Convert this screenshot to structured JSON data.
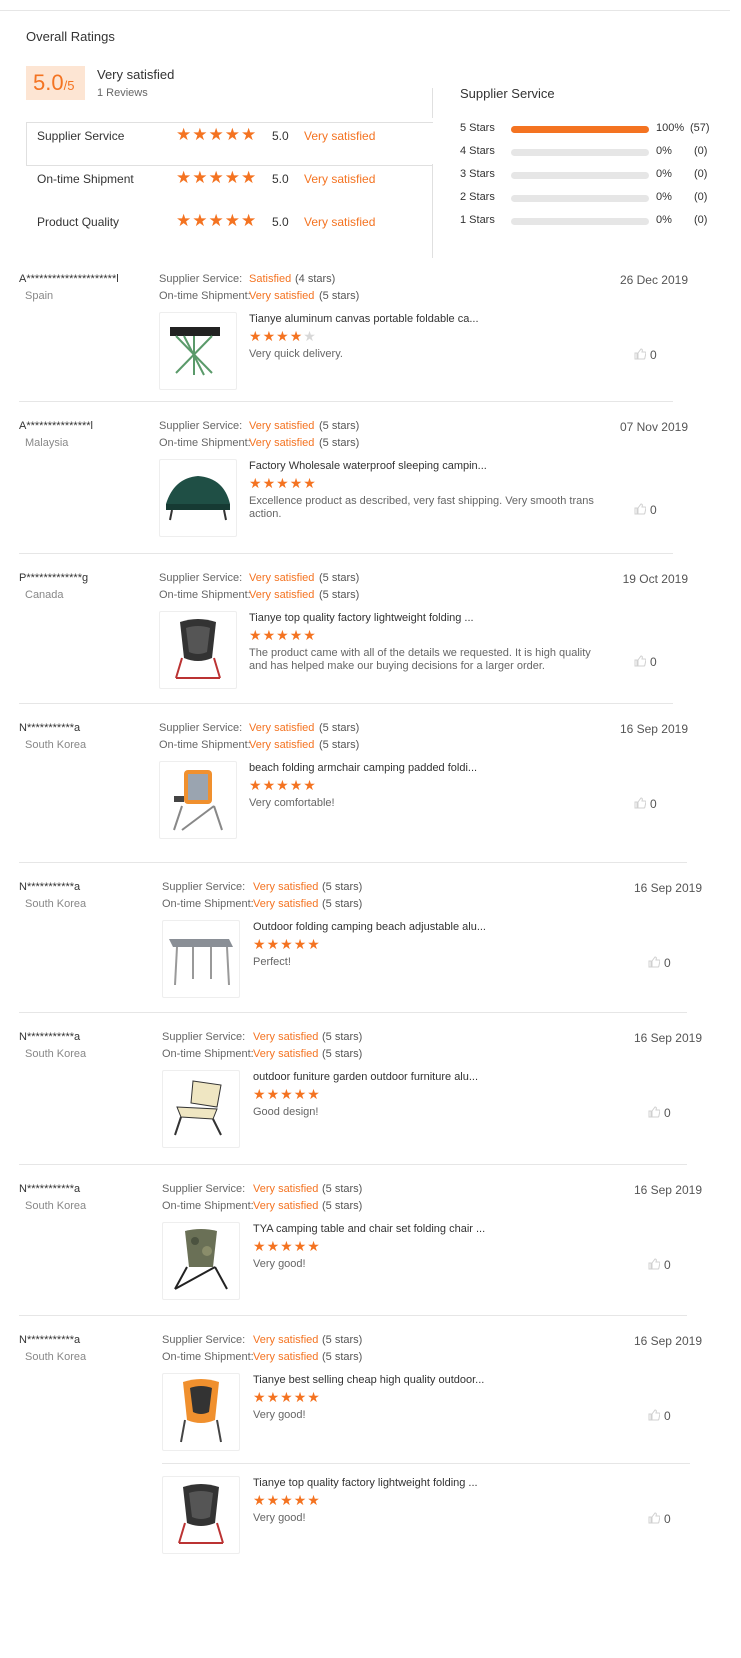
{
  "overall": {
    "title": "Overall Ratings",
    "score": "5.0",
    "score_suffix": "/5",
    "label": "Very satisfied",
    "reviews": "1 Reviews",
    "categories": [
      {
        "name": "Supplier Service",
        "score": "5.0",
        "rating_word": "Very satisfied",
        "stars": 5
      },
      {
        "name": "On-time Shipment",
        "score": "5.0",
        "rating_word": "Very satisfied",
        "stars": 5
      },
      {
        "name": "Product Quality",
        "score": "5.0",
        "rating_word": "Very satisfied",
        "stars": 5
      }
    ]
  },
  "supplier_breakdown": {
    "title": "Supplier Service",
    "rows": [
      {
        "label": "5 Stars",
        "pct": "100%",
        "count": "(57)",
        "fraction": 1.0
      },
      {
        "label": "4 Stars",
        "pct": "0%",
        "count": "(0)",
        "fraction": 0
      },
      {
        "label": "3 Stars",
        "pct": "0%",
        "count": "(0)",
        "fraction": 0
      },
      {
        "label": "2 Stars",
        "pct": "0%",
        "count": "(0)",
        "fraction": 0
      },
      {
        "label": "1 Stars",
        "pct": "0%",
        "count": "(0)",
        "fraction": 0
      }
    ]
  },
  "labels": {
    "supplier_service": "Supplier Service:",
    "ontime_shipment": "On-time Shipment:"
  },
  "reviews": [
    {
      "name": "A*********************l",
      "country": "Spain",
      "supplier_value": "Satisfied",
      "supplier_stars": "(4 stars)",
      "shipment_value": "Very satisfied",
      "shipment_stars": "(5 stars)",
      "date": "26 Dec 2019",
      "products": [
        {
          "title": "Tianye aluminum canvas portable foldable ca...",
          "rating": 4,
          "text": "Very quick delivery.",
          "likes": "0",
          "image": "folding-table-icon"
        }
      ]
    },
    {
      "name": "A***************l",
      "country": "Malaysia",
      "supplier_value": "Very satisfied",
      "supplier_stars": "(5 stars)",
      "shipment_value": "Very satisfied",
      "shipment_stars": "(5 stars)",
      "date": "07 Nov 2019",
      "products": [
        {
          "title": "Factory Wholesale waterproof sleeping campin...",
          "rating": 5,
          "text": "Excellence product as described, very fast shipping. Very smooth trans action.",
          "likes": "0",
          "image": "tent-cot-icon"
        }
      ]
    },
    {
      "name": "P*************g",
      "country": "Canada",
      "supplier_value": "Very satisfied",
      "supplier_stars": "(5 stars)",
      "shipment_value": "Very satisfied",
      "shipment_stars": "(5 stars)",
      "date": "19 Oct 2019",
      "products": [
        {
          "title": "Tianye top quality factory lightweight folding ...",
          "rating": 5,
          "text": "The product came with all of the details we requested.  It is high quality and has helped make our buying decisions for a larger order.",
          "likes": "0",
          "image": "camping-chair-icon"
        }
      ]
    },
    {
      "name": "N***********a",
      "country": "South Korea",
      "supplier_value": "Very satisfied",
      "supplier_stars": "(5 stars)",
      "shipment_value": "Very satisfied",
      "shipment_stars": "(5 stars)",
      "date": "16 Sep 2019",
      "products": [
        {
          "title": "beach folding armchair camping padded foldi...",
          "rating": 5,
          "text": "Very comfortable!",
          "likes": "0",
          "image": "armchair-icon"
        }
      ]
    },
    {
      "name": "N***********a",
      "country": "South Korea",
      "supplier_value": "Very satisfied",
      "supplier_stars": "(5 stars)",
      "shipment_value": "Very satisfied",
      "shipment_stars": "(5 stars)",
      "date": "16 Sep 2019",
      "products": [
        {
          "title": "Outdoor folding camping beach adjustable alu...",
          "rating": 5,
          "text": "Perfect!",
          "likes": "0",
          "image": "alu-table-icon"
        }
      ]
    },
    {
      "name": "N***********a",
      "country": "South Korea",
      "supplier_value": "Very satisfied",
      "supplier_stars": "(5 stars)",
      "shipment_value": "Very satisfied",
      "shipment_stars": "(5 stars)",
      "date": "16 Sep 2019",
      "products": [
        {
          "title": "outdoor funiture garden outdoor furniture alu...",
          "rating": 5,
          "text": "Good design!",
          "likes": "0",
          "image": "garden-chair-icon"
        }
      ]
    },
    {
      "name": "N***********a",
      "country": "South Korea",
      "supplier_value": "Very satisfied",
      "supplier_stars": "(5 stars)",
      "shipment_value": "Very satisfied",
      "shipment_stars": "(5 stars)",
      "date": "16 Sep 2019",
      "products": [
        {
          "title": "TYA camping table and chair set folding chair ...",
          "rating": 5,
          "text": "Very good!",
          "likes": "0",
          "image": "camo-chair-icon"
        }
      ]
    },
    {
      "name": "N***********a",
      "country": "South Korea",
      "supplier_value": "Very satisfied",
      "supplier_stars": "(5 stars)",
      "shipment_value": "Very satisfied",
      "shipment_stars": "(5 stars)",
      "date": "16 Sep 2019",
      "products": [
        {
          "title": "Tianye best selling cheap high quality outdoor...",
          "rating": 5,
          "text": "Very good!",
          "likes": "0",
          "image": "orange-chair-icon"
        },
        {
          "title": "Tianye top quality factory lightweight folding ...",
          "rating": 5,
          "text": "Very good!",
          "likes": "0",
          "image": "camping-chair-icon"
        }
      ]
    }
  ],
  "colors": {
    "accent": "#f47321",
    "muted_star": "#d8d8d8"
  }
}
